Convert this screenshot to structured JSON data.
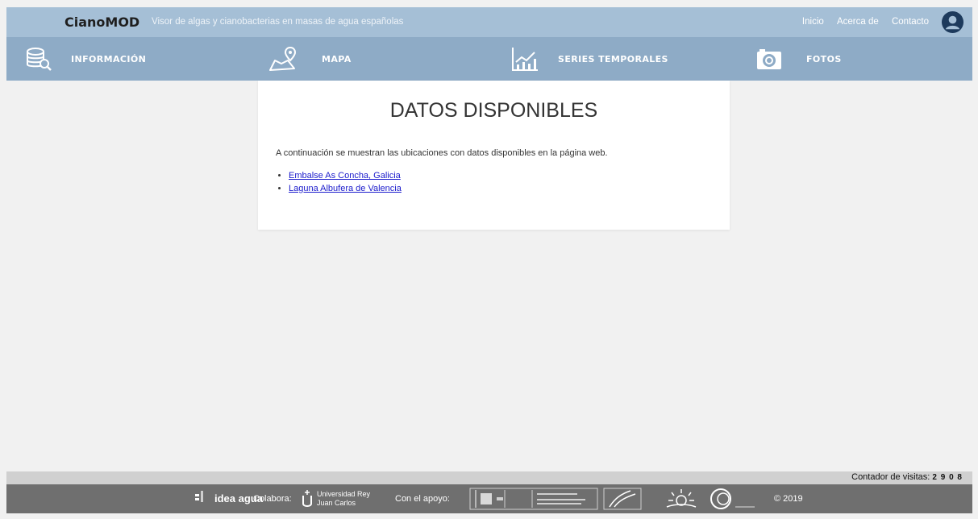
{
  "header": {
    "logo_text": "CianoMOD",
    "tagline": "Visor de algas y cianobacterias en masas de agua españolas",
    "links": [
      "Inicio",
      "Acerca de",
      "Contacto"
    ]
  },
  "nav": {
    "items": [
      {
        "label": "INFORMACIÓN",
        "icon": "database-search-icon"
      },
      {
        "label": "MAPA",
        "icon": "map-pin-icon"
      },
      {
        "label": "SERIES TEMPORALES",
        "icon": "line-chart-icon"
      },
      {
        "label": "FOTOS",
        "icon": "camera-icon"
      }
    ]
  },
  "main": {
    "title": "DATOS DISPONIBLES",
    "intro": "A continuación se muestran las ubicaciones con datos disponibles en la página web.",
    "locations": [
      "Embalse As Concha, Galicia",
      "Laguna Albufera de Valencia"
    ]
  },
  "footer": {
    "counter_label": "Contador de visitas:",
    "counter_value": "2 9 0 8",
    "partner_logo": "idea agua",
    "colabora_label": "Colabora:",
    "university": "Universidad Rey Juan Carlos",
    "apoyo_label": "Con el apoyo:",
    "copyright": "© 2019"
  },
  "colors": {
    "topbar": "#a5bfd6",
    "navbar": "#8eabc6",
    "footer": "#6f6f6f",
    "link": "#1a1acc"
  }
}
